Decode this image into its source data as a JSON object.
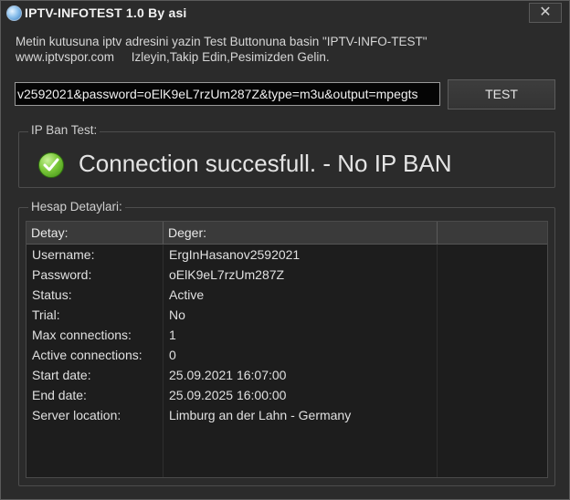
{
  "window": {
    "title": "IPTV-INFOTEST 1.0 By asi",
    "close_label": "✕"
  },
  "instructions": {
    "line1": "Metin kutusuna iptv adresini yazin Test Buttonuna basin \"IPTV-INFO-TEST\"",
    "line2": "www.iptvspor.com     Izleyin,Takip Edin,Pesimizden Gelin."
  },
  "url_input": {
    "value": "v2592021&password=oElK9eL7rzUm287Z&type=m3u&output=mpegts"
  },
  "test_button": {
    "label": "TEST"
  },
  "ip_ban": {
    "label": "IP Ban Test:",
    "icon": "check-circle-icon",
    "message": "Connection succesfull. - No IP BAN"
  },
  "details": {
    "label": "Hesap Detaylari:",
    "columns": [
      "Detay:",
      "Deger:",
      ""
    ],
    "rows": [
      {
        "key": "Username:",
        "value": "ErgInHasanov2592021"
      },
      {
        "key": "Password:",
        "value": "oElK9eL7rzUm287Z"
      },
      {
        "key": "Status:",
        "value": "Active"
      },
      {
        "key": "Trial:",
        "value": "No"
      },
      {
        "key": "Max connections:",
        "value": "1"
      },
      {
        "key": "Active connections:",
        "value": "0"
      },
      {
        "key": "Start date:",
        "value": "25.09.2021 16:07:00"
      },
      {
        "key": "End date:",
        "value": "25.09.2025 16:00:00"
      },
      {
        "key": "Server location:",
        "value": "Limburg an der Lahn - Germany"
      },
      {
        "key": "",
        "value": ""
      },
      {
        "key": "",
        "value": ""
      },
      {
        "key": "",
        "value": ""
      }
    ]
  }
}
